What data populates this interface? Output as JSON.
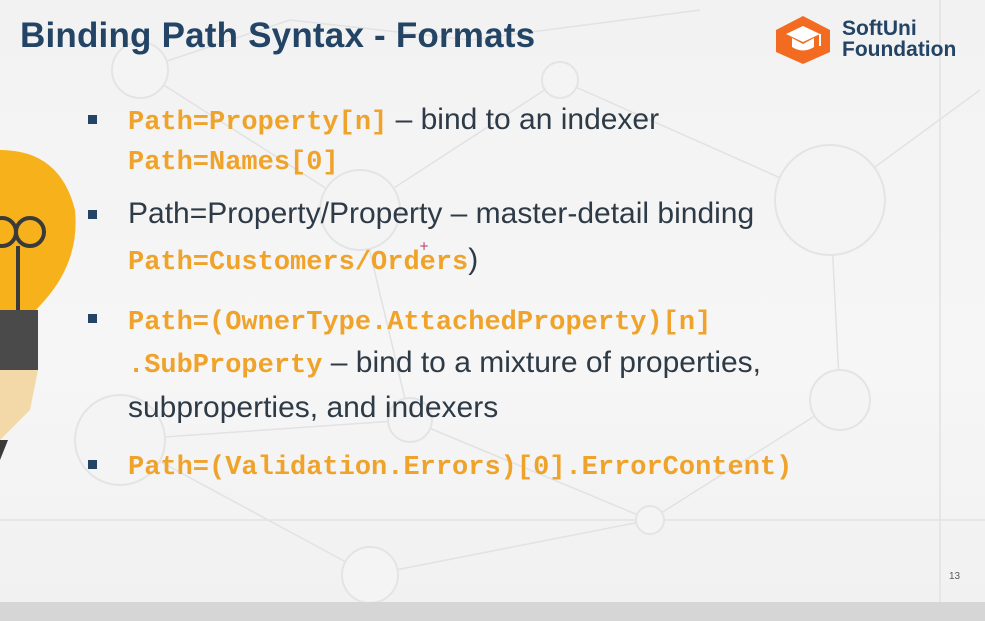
{
  "slide": {
    "title": "Binding Path Syntax - Formats",
    "page_number": "13",
    "logo": {
      "line1": "SoftUni",
      "line2": "Foundation",
      "icon": "graduation-cap-icon",
      "colors": {
        "hexagon": "#f26b21",
        "text": "#234465"
      }
    },
    "bullets": [
      {
        "line1_code": "Path=Property[n]",
        "line1_text": " – bind to an indexer",
        "line2_code": "Path=Names[0]"
      },
      {
        "line1_text": "Path=Property/Property – master-detail binding",
        "line2_code": "Path=Customers/Orders",
        "line2_text": ")"
      },
      {
        "line1_code": "Path=(OwnerType.AttachedProperty)[n]",
        "line2_code": ".SubProperty",
        "line2_text": "  – bind to a mixture of properties,",
        "line3_text": "subproperties, and indexers"
      },
      {
        "line1_code": "Path=(Validation.Errors)[0].ErrorContent)"
      }
    ]
  },
  "colors": {
    "title": "#234465",
    "code": "#f0a32b",
    "body_text": "#2e3b47",
    "bullet_marker": "#234465",
    "bulb_yellow": "#f7b21b"
  }
}
